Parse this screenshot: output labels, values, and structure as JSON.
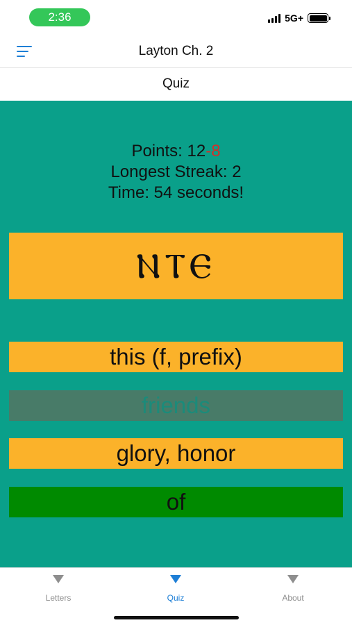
{
  "status_bar": {
    "time": "2:36",
    "network": "5G+",
    "time_color": "#34c759"
  },
  "header": {
    "title": "Layton Ch. 2",
    "menu_icon": "hamburger-menu-icon",
    "accent": "#1e7fd6"
  },
  "sub_header": {
    "title": "Quiz"
  },
  "quiz": {
    "points_label": "Points: ",
    "points_value": "12",
    "points_penalty": "-8",
    "streak_text": "Longest Streak: 2",
    "time_text": "Time: 54 seconds!",
    "prompt": "ⲚⲦⲈ",
    "answers": [
      {
        "label": "this (f, prefix)",
        "state": "default",
        "color": "#fbb22a"
      },
      {
        "label": "friends",
        "state": "disabled",
        "color": "#487b68"
      },
      {
        "label": "glory, honor",
        "state": "default",
        "color": "#fbb22a"
      },
      {
        "label": "of",
        "state": "correct",
        "color": "#008a00"
      }
    ],
    "background": "#0aa08a"
  },
  "tab_bar": {
    "tabs": [
      {
        "label": "Letters",
        "icon": "triangle-down-icon",
        "active": false
      },
      {
        "label": "Quiz",
        "icon": "triangle-down-icon",
        "active": true
      },
      {
        "label": "About",
        "icon": "triangle-down-icon",
        "active": false
      }
    ]
  }
}
